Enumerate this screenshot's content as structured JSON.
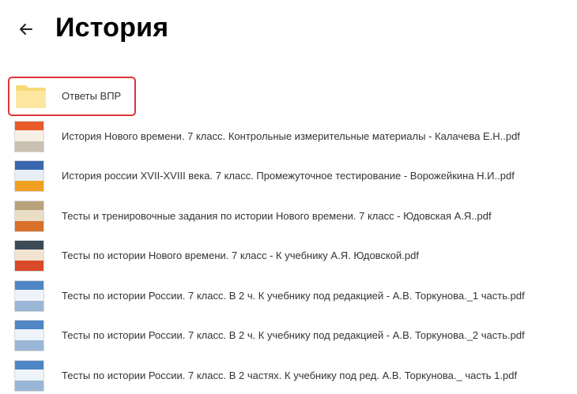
{
  "header": {
    "title": "История"
  },
  "items": [
    {
      "name": "Ответы ВПР",
      "type": "folder",
      "icon": "folder-icon"
    },
    {
      "name": "История Нового времени. 7 класс. Контрольные измерительные материалы - Калачева Е.Н..pdf",
      "type": "pdf",
      "icon": "book-cover-icon",
      "colors": [
        "#e85a2a",
        "#f6efe6",
        "#c9c0b2"
      ]
    },
    {
      "name": "История россии XVII-XVIII века. 7 класс. Промежуточное тестирование - Ворожейкина Н.И..pdf",
      "type": "pdf",
      "icon": "book-cover-icon",
      "colors": [
        "#3a67b0",
        "#e8eef6",
        "#f0a020"
      ]
    },
    {
      "name": "Тесты и тренировочные задания по истории Нового времени. 7 класс - Юдовская А.Я..pdf",
      "type": "pdf",
      "icon": "book-cover-icon",
      "colors": [
        "#b7a27c",
        "#e9ddc6",
        "#d9702a"
      ]
    },
    {
      "name": "Тесты по истории Нового времени. 7 класс - К учебнику А.Я. Юдовской.pdf",
      "type": "pdf",
      "icon": "book-cover-icon",
      "colors": [
        "#3a4a56",
        "#f1e3cf",
        "#d84a2a"
      ]
    },
    {
      "name": "Тесты по истории России. 7 класс. В 2 ч. К учебнику под редакцией - А.В. Торкунова._1 часть.pdf",
      "type": "pdf",
      "icon": "book-cover-icon",
      "colors": [
        "#4f86c6",
        "#eef3f9",
        "#9ab6d6"
      ]
    },
    {
      "name": "Тесты по истории России. 7 класс. В 2 ч. К учебнику под редакцией - А.В. Торкунова._2 часть.pdf",
      "type": "pdf",
      "icon": "book-cover-icon",
      "colors": [
        "#4f86c6",
        "#eef3f9",
        "#9ab6d6"
      ]
    },
    {
      "name": "Тесты по истории России. 7 класс. В 2 частях. К учебнику под ред. А.В. Торкунова._ часть 1.pdf",
      "type": "pdf",
      "icon": "book-cover-icon",
      "colors": [
        "#4f86c6",
        "#eef3f9",
        "#9ab6d6"
      ]
    }
  ]
}
